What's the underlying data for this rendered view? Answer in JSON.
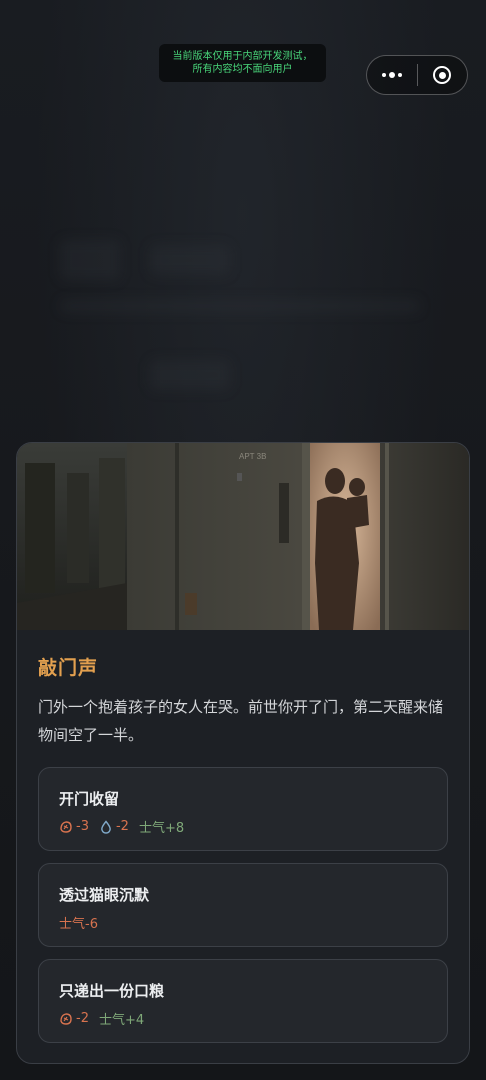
{
  "dev_notice": {
    "line1": "当前版本仅用于内部开发测试，",
    "line2": "所有内容均不面向用户"
  },
  "capsule": {
    "more_icon": "more-dots-icon",
    "close_icon": "target-close-icon"
  },
  "event": {
    "image_sign": "APT 3B",
    "title": "敲门声",
    "description": "门外一个抱着孩子的女人在哭。前世你开了门，第二天醒来储物间空了一半。"
  },
  "options": [
    {
      "label": "开门收留",
      "effects": [
        {
          "icon": "food-icon",
          "text": "-3",
          "tone": "negative"
        },
        {
          "icon": "water-drop-icon",
          "text": "-2",
          "tone": "negative"
        },
        {
          "text": "士气+8",
          "tone": "positive"
        }
      ]
    },
    {
      "label": "透过猫眼沉默",
      "effects": [
        {
          "text": "士气-6",
          "tone": "negative"
        }
      ]
    },
    {
      "label": "只递出一份口粮",
      "effects": [
        {
          "icon": "food-icon",
          "text": "-2",
          "tone": "negative"
        },
        {
          "text": "士气+4",
          "tone": "positive"
        }
      ]
    }
  ],
  "colors": {
    "accent": "#e3a04f",
    "negative": "#d8734f",
    "positive": "#7fa878",
    "notice_text": "#49d67a"
  }
}
